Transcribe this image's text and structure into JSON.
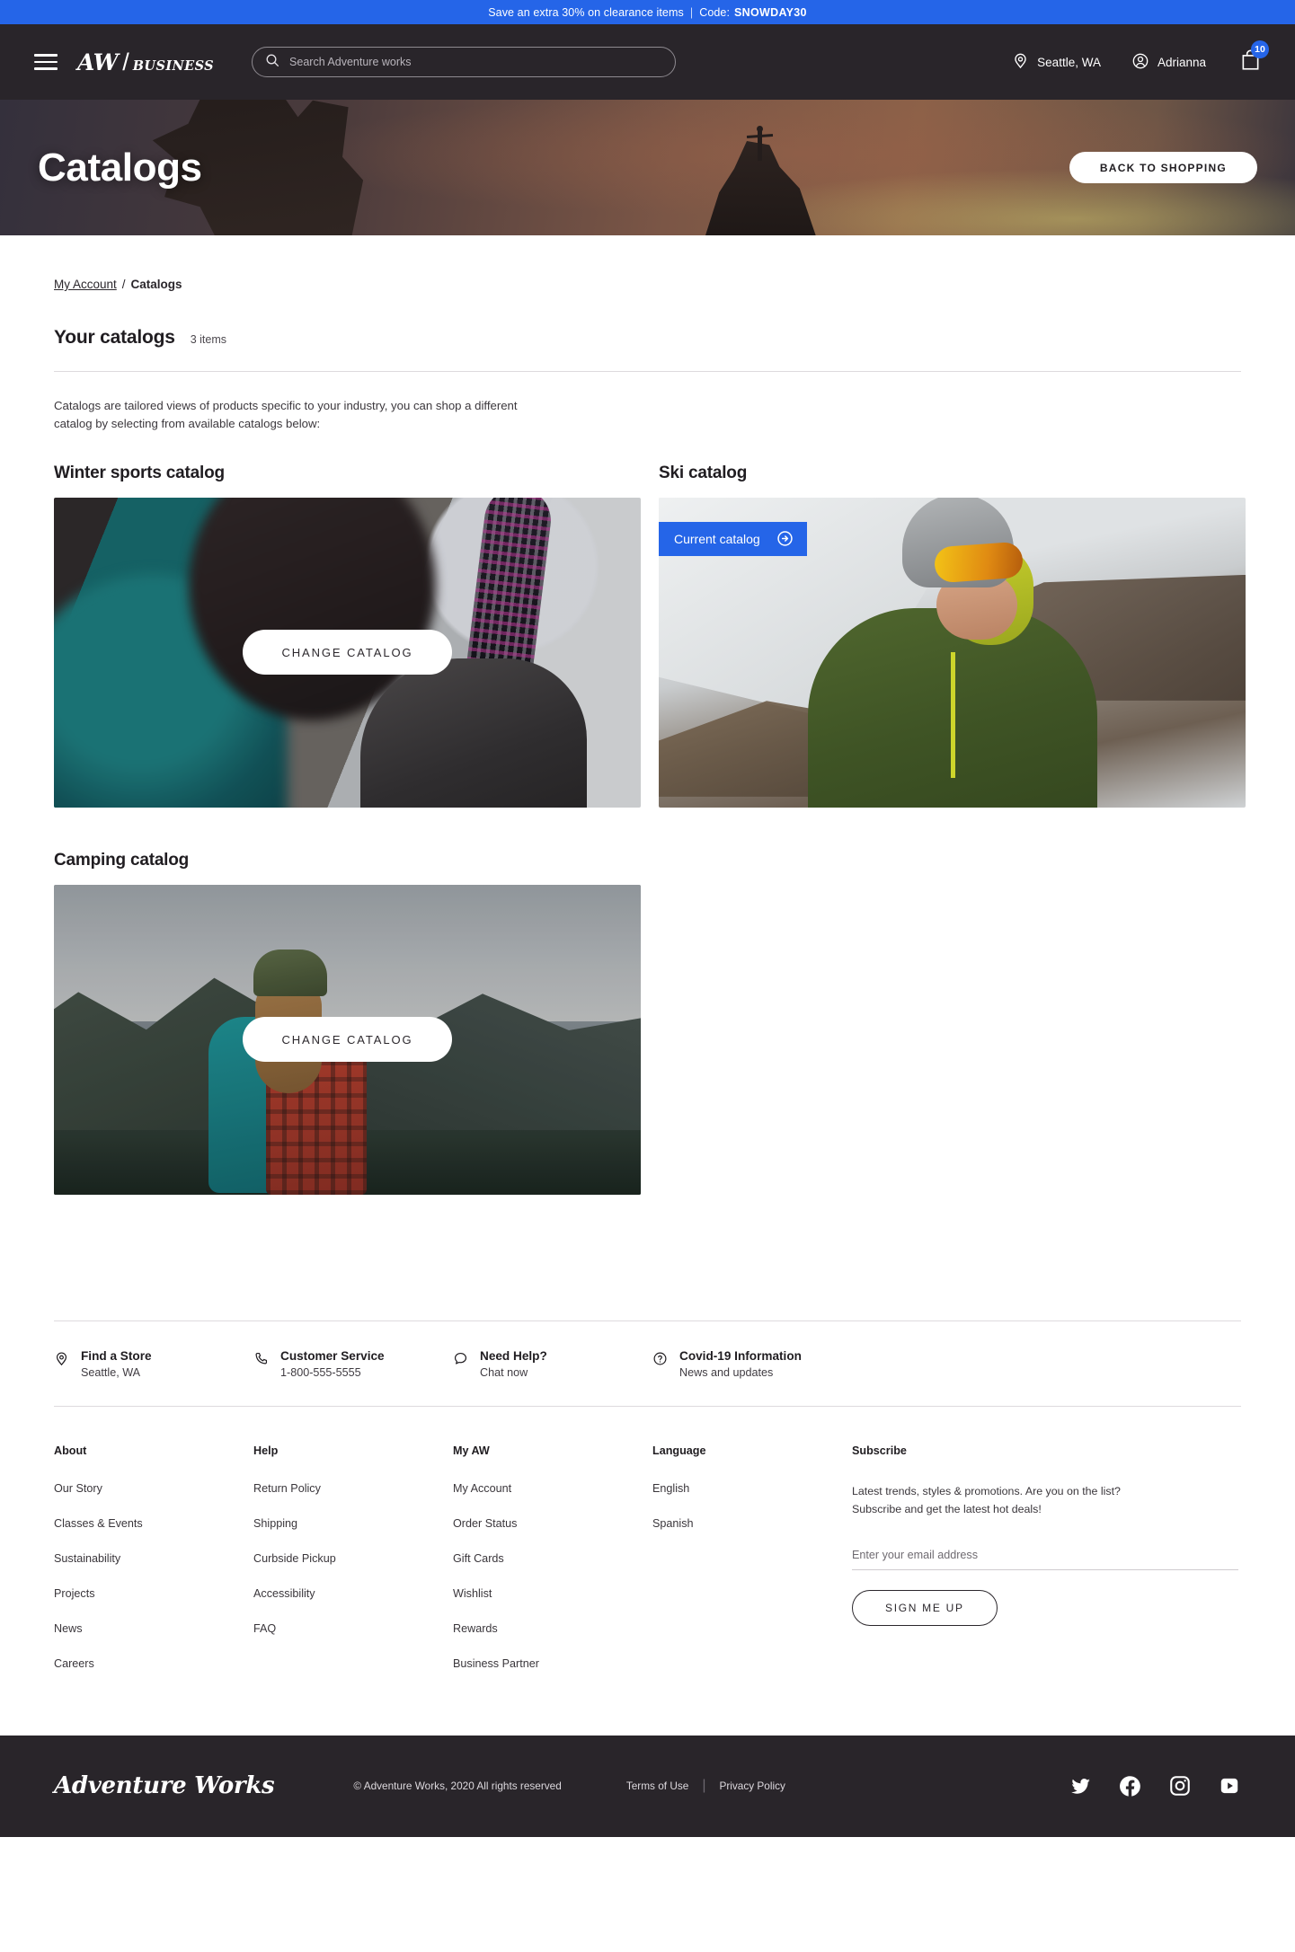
{
  "promo": {
    "text": "Save an extra 30% on clearance items",
    "separator": "|",
    "code_label": "Code:",
    "code": "SNOWDAY30",
    "bg_color": "#2565E8"
  },
  "header": {
    "menu_icon": "hamburger-icon",
    "logo_mark": "AW",
    "logo_slash": "/",
    "logo_sub": "BUSINESS",
    "search": {
      "placeholder": "Search Adventure works",
      "value": "",
      "icon": "search-icon"
    },
    "location": {
      "icon": "map-pin-icon",
      "label": "Seattle, WA"
    },
    "account": {
      "icon": "user-circle-icon",
      "label": "Adrianna"
    },
    "cart": {
      "icon": "shopping-bag-icon",
      "count": "10",
      "badge_color": "#2565E8"
    }
  },
  "hero": {
    "title": "Catalogs",
    "button_label": "BACK TO SHOPPING"
  },
  "breadcrumb": {
    "parent": "My Account",
    "separator": "/",
    "current": "Catalogs"
  },
  "section": {
    "title": "Your catalogs",
    "count": "3 items",
    "description": "Catalogs are tailored views of products specific to your industry, you can shop a different catalog by selecting from available catalogs below:"
  },
  "catalogs": [
    {
      "title": "Winter sports catalog",
      "button_label": "CHANGE CATALOG",
      "is_current": false,
      "image_alt": "snowboarders-laughing-in-snow"
    },
    {
      "title": "Ski catalog",
      "badge_label": "Current catalog",
      "badge_icon": "arrow-right-circle-icon",
      "is_current": true,
      "image_alt": "skier-with-helmet-and-goggles"
    },
    {
      "title": "Camping catalog",
      "button_label": "CHANGE CATALOG",
      "is_current": false,
      "image_alt": "hiker-overlooking-lake"
    }
  ],
  "services": [
    {
      "icon": "map-pin-icon",
      "title": "Find a Store",
      "subtitle": "Seattle, WA"
    },
    {
      "icon": "phone-icon",
      "title": "Customer Service",
      "subtitle": "1-800-555-5555"
    },
    {
      "icon": "chat-bubble-icon",
      "title": "Need Help?",
      "subtitle": "Chat now"
    },
    {
      "icon": "question-mark-circle-icon",
      "title": "Covid-19 Information",
      "subtitle": "News and updates"
    }
  ],
  "footer_columns": [
    {
      "heading": "About",
      "links": [
        "Our Story",
        "Classes & Events",
        "Sustainability",
        "Projects",
        "News",
        "Careers"
      ]
    },
    {
      "heading": "Help",
      "links": [
        "Return Policy",
        "Shipping",
        "Curbside Pickup",
        "Accessibility",
        "FAQ"
      ]
    },
    {
      "heading": "My AW",
      "links": [
        "My Account",
        "Order Status",
        "Gift Cards",
        "Wishlist",
        "Rewards",
        "Business Partner"
      ]
    },
    {
      "heading": "Language",
      "links": [
        "English",
        "Spanish"
      ]
    }
  ],
  "subscribe": {
    "heading": "Subscribe",
    "copy_line1": "Latest trends, styles & promotions. Are you on the list?",
    "copy_line2": "Subscribe and get the latest hot deals!",
    "placeholder": "Enter your email address",
    "value": "",
    "button_label": "SIGN ME UP"
  },
  "footer_bottom": {
    "logo": "Adventure Works",
    "copyright": "© Adventure Works, 2020 All rights reserved",
    "terms": "Terms of Use",
    "divider": "|",
    "privacy": "Privacy Policy",
    "social": [
      "twitter-icon",
      "facebook-icon",
      "instagram-icon",
      "youtube-icon"
    ]
  }
}
